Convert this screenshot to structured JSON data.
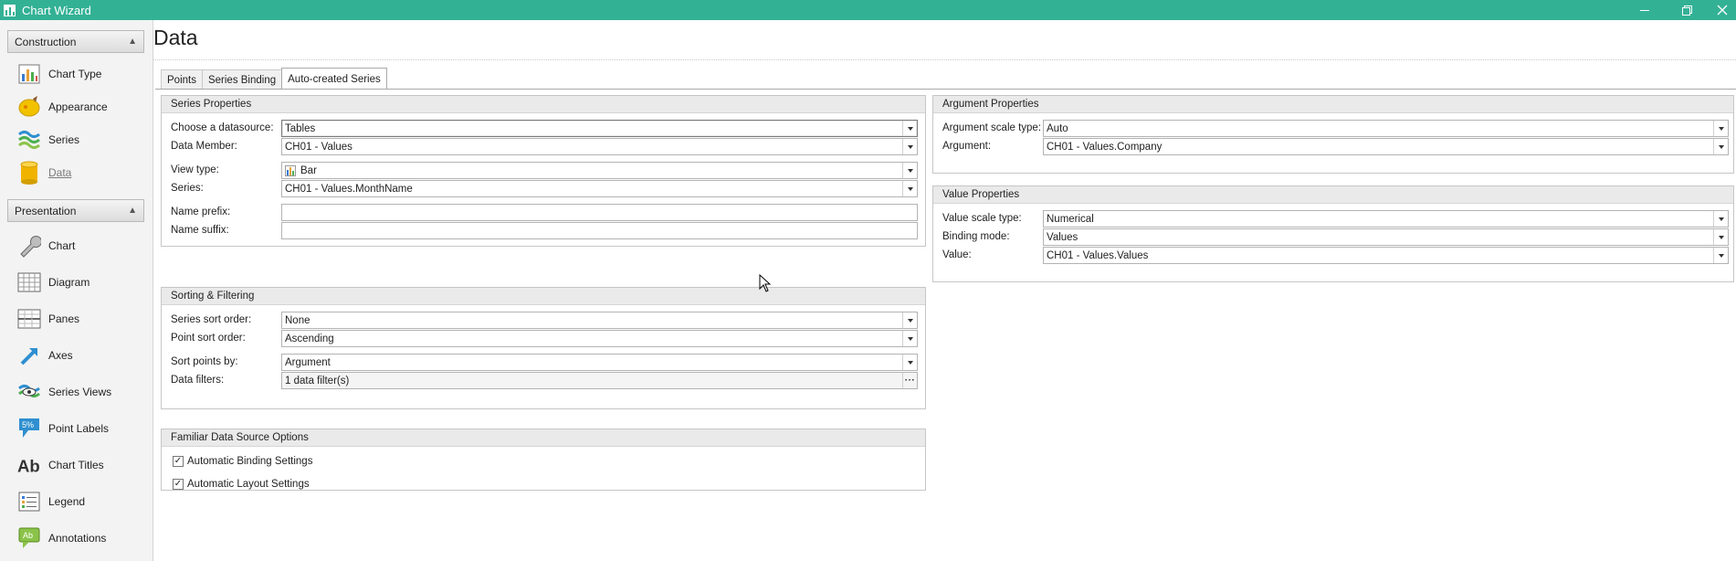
{
  "window": {
    "title": "Chart Wizard"
  },
  "nav": {
    "groups": [
      {
        "label": "Construction",
        "items": [
          {
            "label": "Chart Type",
            "icon": "chart-type-icon"
          },
          {
            "label": "Appearance",
            "icon": "appearance-icon"
          },
          {
            "label": "Series",
            "icon": "series-icon"
          },
          {
            "label": "Data",
            "icon": "data-icon",
            "selected": true
          }
        ]
      },
      {
        "label": "Presentation",
        "items": [
          {
            "label": "Chart",
            "icon": "wrench-icon"
          },
          {
            "label": "Diagram",
            "icon": "diagram-icon"
          },
          {
            "label": "Panes",
            "icon": "panes-icon"
          },
          {
            "label": "Axes",
            "icon": "axes-icon"
          },
          {
            "label": "Series Views",
            "icon": "series-views-icon"
          },
          {
            "label": "Point Labels",
            "icon": "point-labels-icon"
          },
          {
            "label": "Chart Titles",
            "icon": "chart-titles-icon"
          },
          {
            "label": "Legend",
            "icon": "legend-icon"
          },
          {
            "label": "Annotations",
            "icon": "annotations-icon"
          }
        ]
      }
    ]
  },
  "main": {
    "title": "Data",
    "tabs": [
      {
        "label": "Points"
      },
      {
        "label": "Series Binding"
      },
      {
        "label": "Auto-created Series",
        "active": true
      }
    ]
  },
  "series_properties": {
    "title": "Series Properties",
    "datasource_label": "Choose a datasource:",
    "datasource_value": "Tables",
    "data_member_label": "Data Member:",
    "data_member_value": "CH01 - Values",
    "view_type_label": "View type:",
    "view_type_value": "Bar",
    "series_label": "Series:",
    "series_value": "CH01 - Values.MonthName",
    "name_prefix_label": "Name prefix:",
    "name_prefix_value": "",
    "name_suffix_label": "Name suffix:",
    "name_suffix_value": ""
  },
  "sorting": {
    "title": "Sorting & Filtering",
    "series_sort_label": "Series sort order:",
    "series_sort_value": "None",
    "point_sort_label": "Point sort order:",
    "point_sort_value": "Ascending",
    "sort_points_label": "Sort points by:",
    "sort_points_value": "Argument",
    "data_filters_label": "Data filters:",
    "data_filters_value": "1 data filter(s)"
  },
  "familiar": {
    "title": "Familiar Data Source Options",
    "auto_binding_label": "Automatic Binding Settings",
    "auto_binding_checked": true,
    "auto_layout_label": "Automatic Layout Settings",
    "auto_layout_checked": true
  },
  "argument_properties": {
    "title": "Argument Properties",
    "scale_type_label": "Argument scale type:",
    "scale_type_value": "Auto",
    "argument_label": "Argument:",
    "argument_value": "CH01 - Values.Company"
  },
  "value_properties": {
    "title": "Value Properties",
    "scale_type_label": "Value scale type:",
    "scale_type_value": "Numerical",
    "binding_mode_label": "Binding mode:",
    "binding_mode_value": "Values",
    "value_label": "Value:",
    "value_value": "CH01 - Values.Values"
  },
  "colors": {
    "titlebar": "#33b195"
  }
}
